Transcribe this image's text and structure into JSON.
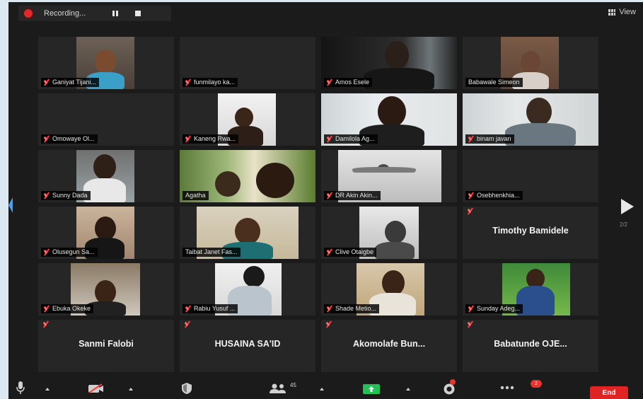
{
  "recording": {
    "label": "Recording..."
  },
  "view": {
    "label": "View"
  },
  "pagination": {
    "indicator": "2/2"
  },
  "participants": [
    {
      "name": "Ganiyat Tijani...",
      "video": true
    },
    {
      "name": "funmilayo ka...",
      "video": false
    },
    {
      "name": "Amos Esele",
      "video": true
    },
    {
      "name": "Babawale Simeon",
      "video": true,
      "muted": false
    },
    {
      "name": "Omowaye Ol...",
      "video": false
    },
    {
      "name": "Kaneng Rwa...",
      "video": true
    },
    {
      "name": "Damilola Ag...",
      "video": true
    },
    {
      "name": "binam javan",
      "video": true
    },
    {
      "name": "Sunny Dada",
      "video": true
    },
    {
      "name": "Agatha",
      "video": true,
      "muted": false
    },
    {
      "name": "DR Akin Akin...",
      "video": true
    },
    {
      "name": "Osebhenkhia...",
      "video": false
    },
    {
      "name": "Olusegun Sa...",
      "video": true
    },
    {
      "name": "Taibat Janet Fas...",
      "video": true,
      "muted": false
    },
    {
      "name": "Clive Otaigbe",
      "video": true
    },
    {
      "name": "Timothy Bamidele",
      "video": false,
      "big": true
    },
    {
      "name": "Ebuka Okeke",
      "video": true
    },
    {
      "name": "Rabiu Yusuf ...",
      "video": true
    },
    {
      "name": "Shade Metio...",
      "video": true
    },
    {
      "name": "Sunday Adeg...",
      "video": true
    },
    {
      "name": "Sanmi Falobi",
      "video": false,
      "big": true
    },
    {
      "name": "HUSAINA SA'ID",
      "video": false,
      "big": true
    },
    {
      "name": "Akomolafe Bun...",
      "video": false,
      "big": true
    },
    {
      "name": "Babatunde OJE...",
      "video": false,
      "big": true
    }
  ],
  "toolbar": {
    "participants_count": "45",
    "chat_badge": "2",
    "end_label": "End"
  },
  "colors": {
    "accent": "#3ea3ff",
    "danger": "#e02424",
    "muted_mic": "#ff3b3b"
  }
}
